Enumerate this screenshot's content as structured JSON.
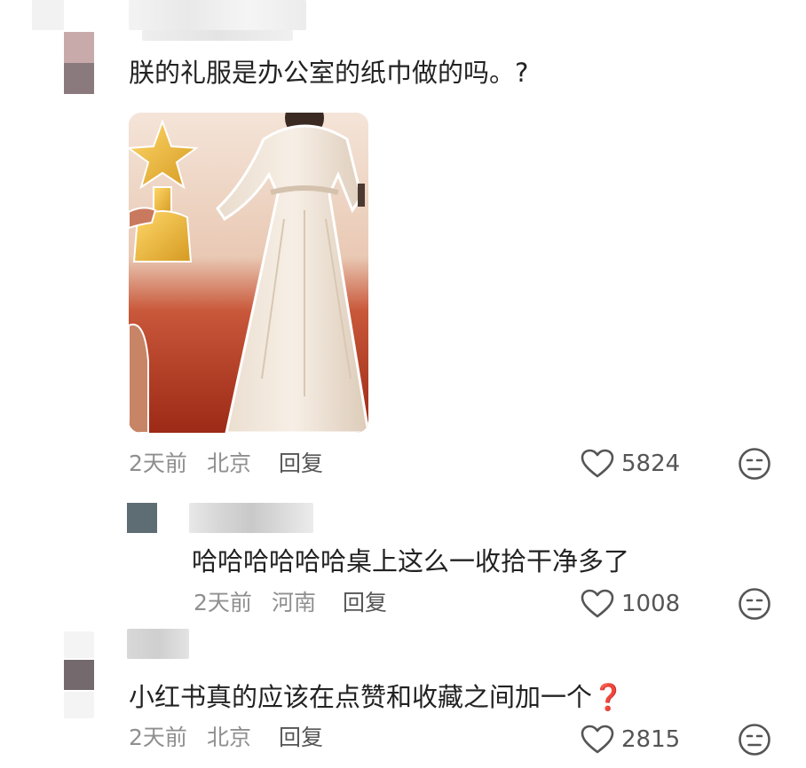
{
  "comments": [
    {
      "text": "朕的礼服是办公室的纸巾做的吗。?",
      "time": "2天前",
      "location": "北京",
      "reply_label": "回复",
      "likes": "5824"
    },
    {
      "text": "哈哈哈哈哈哈桌上这么一收拾干净多了",
      "time": "2天前",
      "location": "河南",
      "reply_label": "回复",
      "likes": "1008"
    },
    {
      "text": "小红书真的应该在点赞和收藏之间加一个",
      "emoji": "❓",
      "time": "2天前",
      "location": "北京",
      "reply_label": "回复",
      "likes": "2815"
    }
  ],
  "icons": {
    "like": "heart-outline-icon",
    "emoji": "neutral-face-icon",
    "question": "red-question-mark-emoji"
  },
  "colors": {
    "text": "#222222",
    "meta": "#8f8f8f",
    "icon": "#555555",
    "question_red": "#e0242f"
  }
}
